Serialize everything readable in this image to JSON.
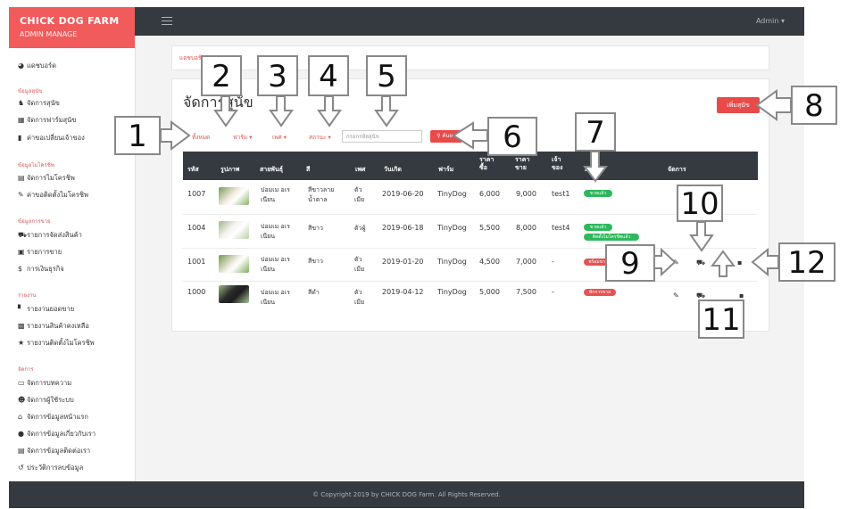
{
  "brand": {
    "title": "CHICK DOG FARM",
    "subtitle": "ADMIN MANAGE"
  },
  "topbar": {
    "user": "Admin ▾"
  },
  "sidebar": {
    "dashboard": "แดชบอร์ด",
    "sections": [
      {
        "heading": "ข้อมูลสุนัข",
        "items": [
          "จัดการสุนัข",
          "จัดการฟาร์มสุนัข",
          "ค่าขอเปลี่ยนเจ้าของ"
        ]
      },
      {
        "heading": "ข้อมูลไมโครชิพ",
        "items": [
          "จัดการไมโครชิพ",
          "ค่าขอติดตั้งไมโครชิพ"
        ]
      },
      {
        "heading": "ข้อมูลการขาย",
        "items": [
          "รายการจัดส่งสินค้า",
          "รายการขาย",
          "การเงินธุรกิจ"
        ]
      },
      {
        "heading": "รายงาน",
        "items": [
          "รายงานยอดขาย",
          "รายงานสินค้าคงเหลือ",
          "รายงานติดตั้งไมโครชิพ"
        ]
      },
      {
        "heading": "จัดการ",
        "items": [
          "จัดการบทความ",
          "จัดการผู้ใช้ระบบ",
          "จัดการข้อมูลหน้าแรก",
          "จัดการข้อมูลเกี่ยวกับเรา",
          "จัดการข้อมูลติดต่อเรา",
          "ประวัติการลบข้อมูล"
        ]
      }
    ]
  },
  "breadcrumb": "แดชบอร์ด / จัดการสุนัข",
  "page": {
    "title": "จัดการสุนัข",
    "add_button": "เพิ่มสุนัข",
    "filters": {
      "all": "ทั้งหมด",
      "farm": "ฟาร์ม ▾",
      "sex": "เพศ ▾",
      "status": "สถานะ ▾"
    },
    "search_placeholder": "กรอกรหัสสุนัข",
    "search_button": "ค้นหา"
  },
  "table": {
    "headers": [
      "รหัส",
      "รูปภาพ",
      "สายพันธุ์",
      "สี",
      "เพศ",
      "วันเกิด",
      "ฟาร์ม",
      "ราคา ซื้อ",
      "ราคา ขาย",
      "เจ้า ของ",
      "สถานะ",
      "จัดการ"
    ],
    "rows": [
      {
        "id": "1007",
        "breed": "ปอมเม อเรเนียน",
        "color": "สีขาวลาย น้ำตาล",
        "sex": "ตัว เมีย",
        "birth": "2019-06-20",
        "farm": "TinyDog",
        "buy": "6,000",
        "sell": "9,000",
        "owner": "test1",
        "status": [
          "ขายแล้ว"
        ]
      },
      {
        "id": "1004",
        "breed": "ปอมเม อเรเนียน",
        "color": "สีขาว",
        "sex": "ตัวผู้",
        "birth": "2019-06-18",
        "farm": "TinyDog",
        "buy": "5,500",
        "sell": "8,000",
        "owner": "test4",
        "status": [
          "ขายแล้ว",
          "ติดตั้งไมโครชิพแล้ว"
        ]
      },
      {
        "id": "1001",
        "breed": "ปอมเม อเรเนียน",
        "color": "สีขาว",
        "sex": "ตัว เมีย",
        "birth": "2019-01-20",
        "farm": "TinyDog",
        "buy": "4,500",
        "sell": "7,000",
        "owner": "-",
        "status": [
          "พร้อมขาย"
        ]
      },
      {
        "id": "1000",
        "breed": "ปอมเม อเรเนียน",
        "color": "สีดำ",
        "sex": "ตัว เมีย",
        "birth": "2019-04-12",
        "farm": "TinyDog",
        "buy": "5,000",
        "sell": "7,500",
        "owner": "-",
        "status": [
          "พักการขาย"
        ]
      }
    ]
  },
  "footer": "© Copyright 2019 by CHICK DOG Farm. All Rights Reserved.",
  "callouts": [
    "1",
    "2",
    "3",
    "4",
    "5",
    "6",
    "7",
    "8",
    "9",
    "10",
    "11",
    "12"
  ],
  "colors": {
    "brand": "#f15b5b",
    "topbar": "#343a40",
    "sold": "#2eb85c",
    "unavailable": "#e55353"
  }
}
